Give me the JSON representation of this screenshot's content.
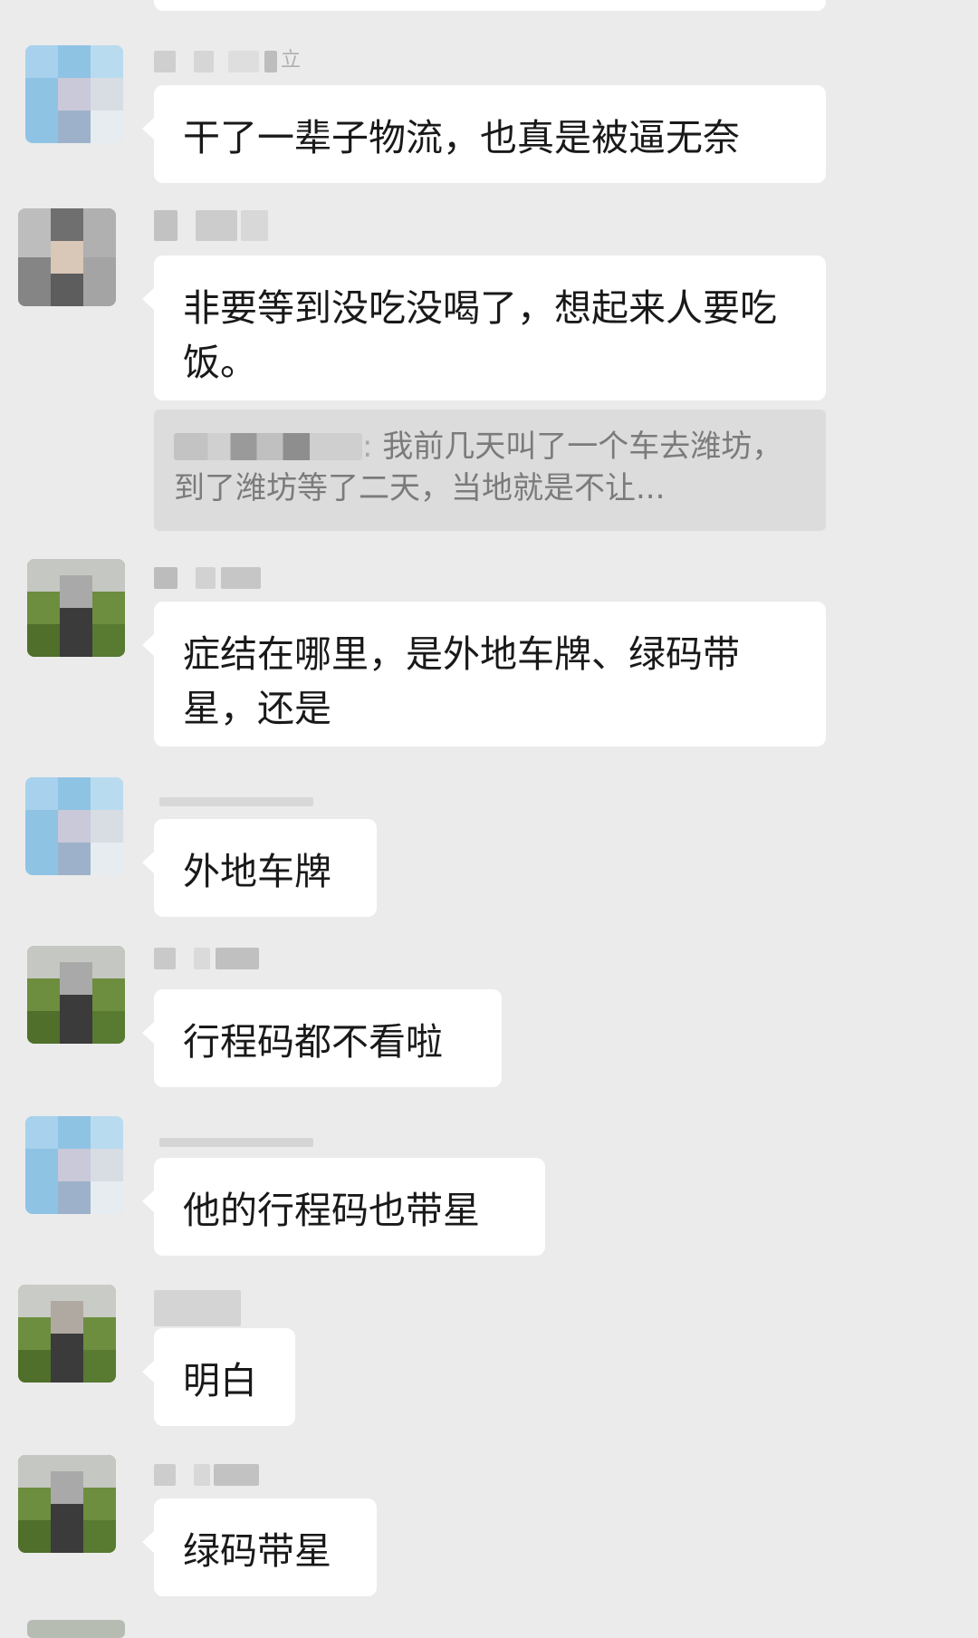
{
  "messages": [
    {
      "sender": "",
      "text": "干了一辈子物流，也真是被逼无奈"
    },
    {
      "sender": "",
      "text": "非要等到没吃没喝了，想起来人要吃饭。",
      "quote": {
        "sender": "",
        "text": "我前几天叫了一个车去潍坊，到了潍坊等了二天，当地就是不让..."
      }
    },
    {
      "sender": "",
      "text": "症结在哪里，是外地车牌、绿码带星，还是"
    },
    {
      "sender": "",
      "text": "外地车牌"
    },
    {
      "sender": "",
      "text": "行程码都不看啦"
    },
    {
      "sender": "",
      "text": "他的行程码也带星"
    },
    {
      "sender": "",
      "text": "明白"
    },
    {
      "sender": "",
      "text": "绿码带星"
    }
  ],
  "quote_separator": ":",
  "nick_fragments": [
    "立"
  ],
  "colors": {
    "background": "#ebebeb",
    "bubble": "#ffffff",
    "quote_background": "#dcdcdc",
    "text": "#191919",
    "quote_text": "#7b7b7b"
  },
  "icons": [
    "avatar-mosaic-sky-icon",
    "avatar-mosaic-person-icon",
    "avatar-mosaic-lawn-icon"
  ]
}
